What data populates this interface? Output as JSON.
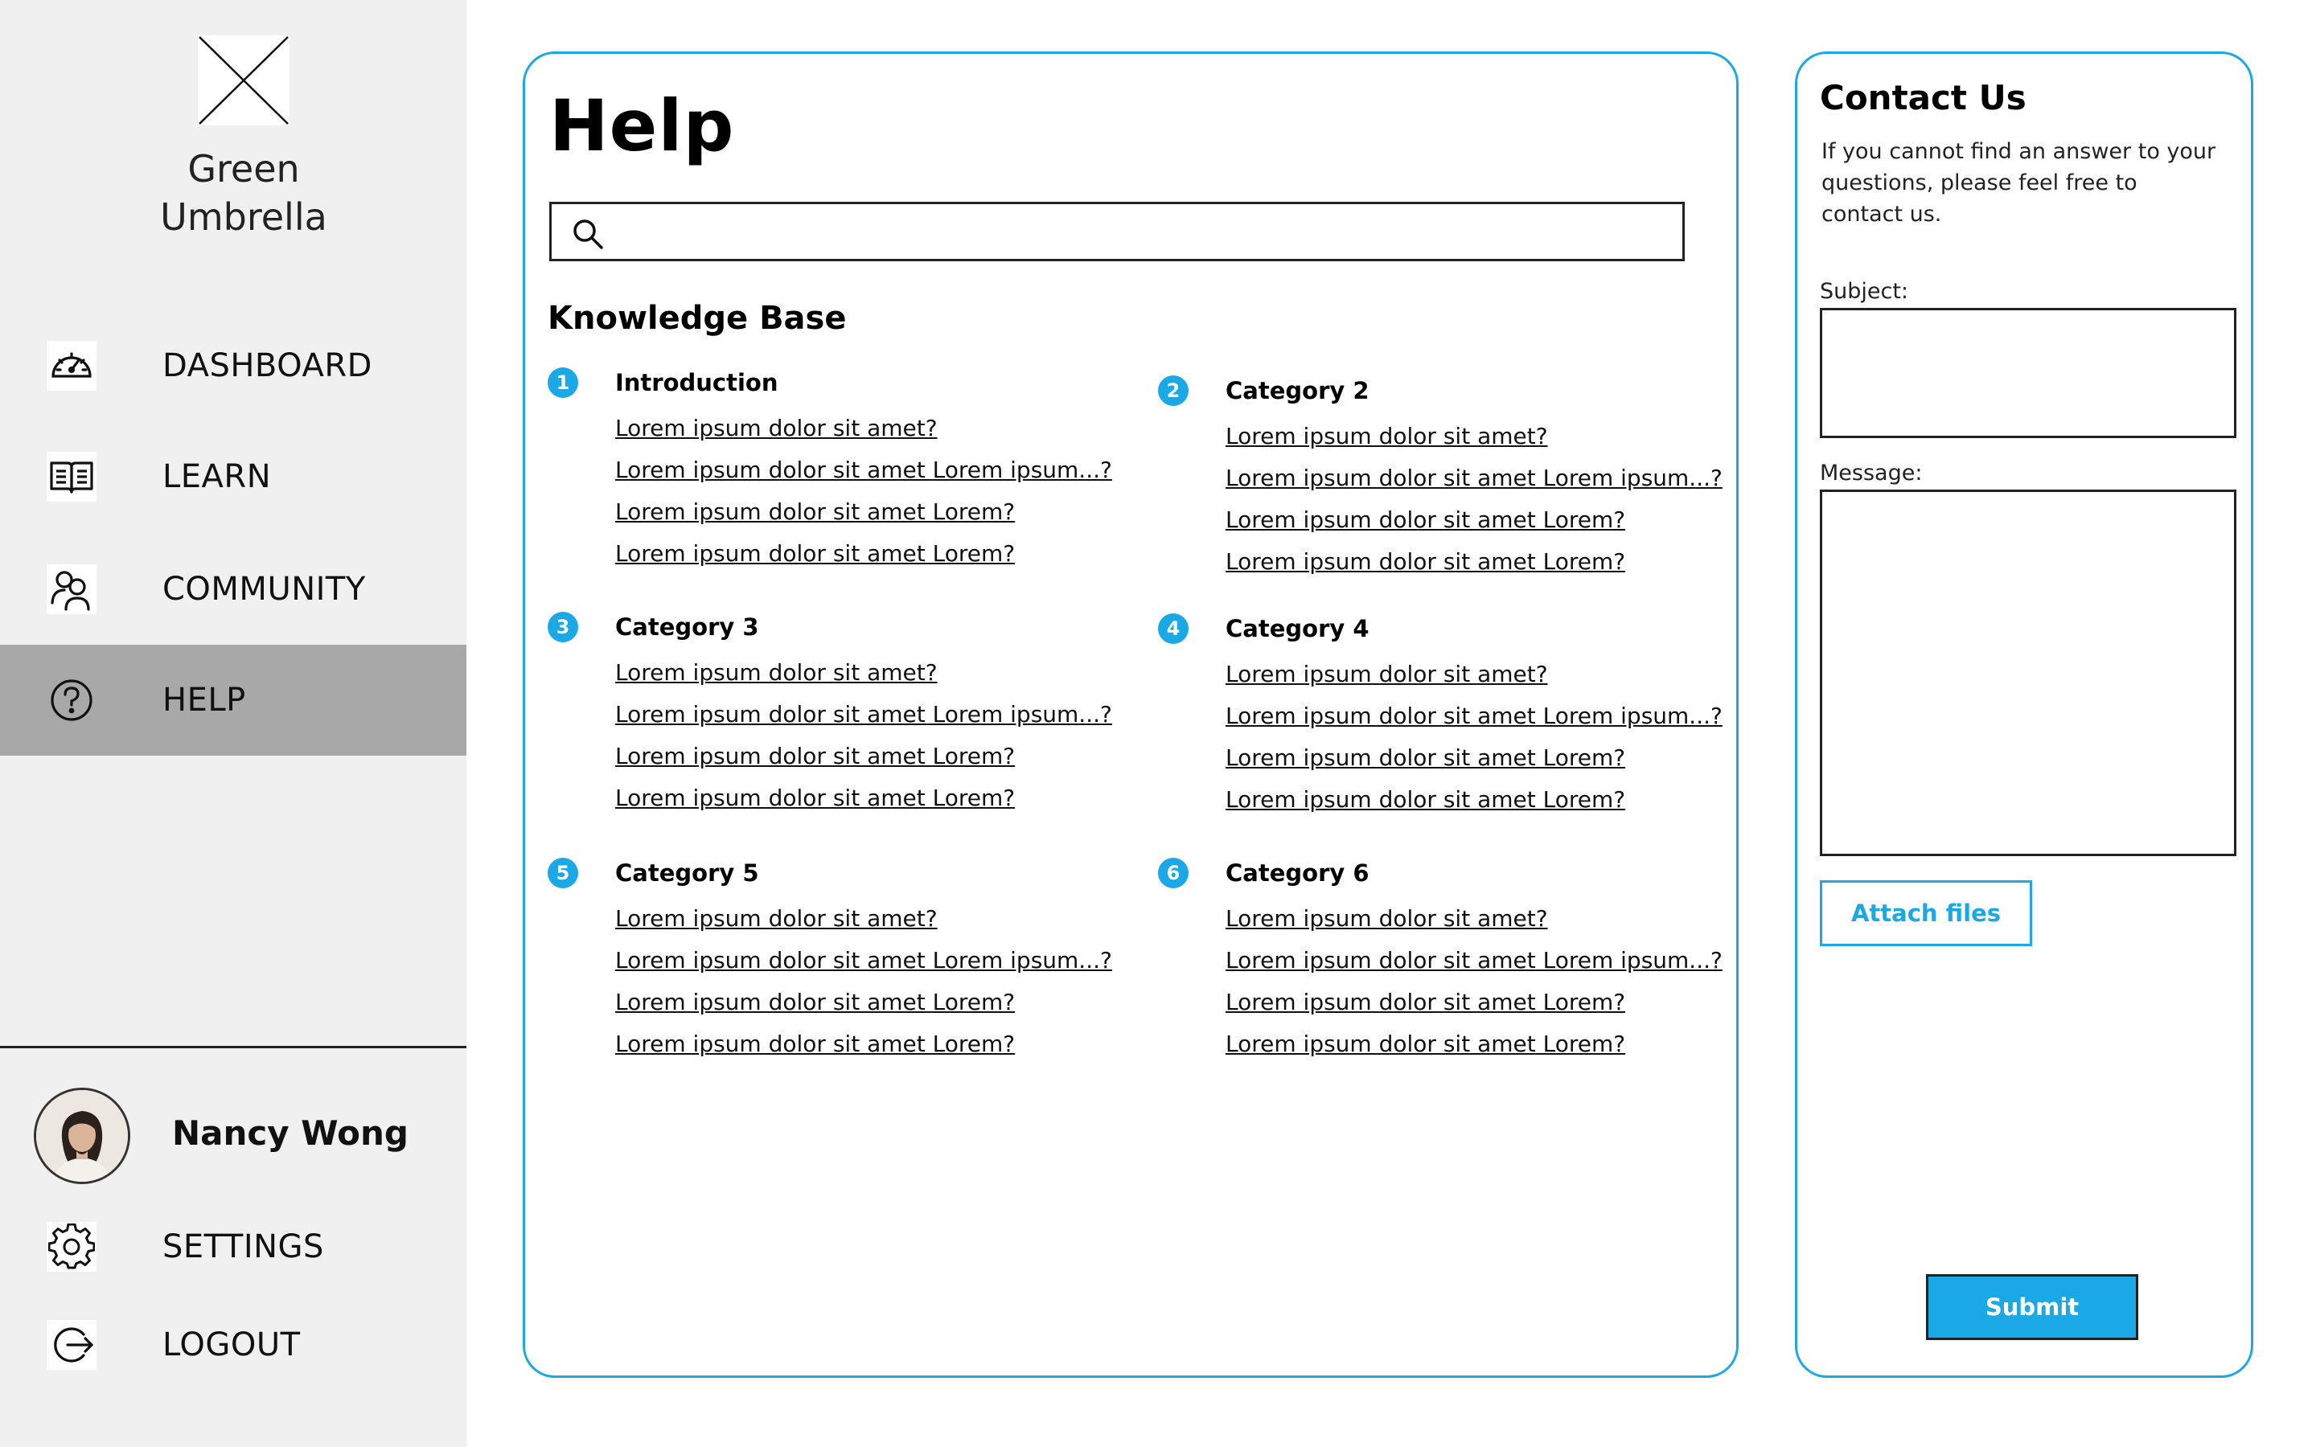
{
  "brand": {
    "line1": "Green",
    "line2": "Umbrella"
  },
  "sidebar": {
    "items": [
      {
        "label": "DASHBOARD",
        "icon": "gauge-icon"
      },
      {
        "label": "LEARN",
        "icon": "book-icon"
      },
      {
        "label": "COMMUNITY",
        "icon": "users-icon"
      },
      {
        "label": "HELP",
        "icon": "help-circle-icon",
        "active": true
      }
    ],
    "bottom_items": [
      {
        "label": "SETTINGS",
        "icon": "gear-icon"
      },
      {
        "label": "LOGOUT",
        "icon": "logout-icon"
      }
    ]
  },
  "user": {
    "name": "Nancy Wong"
  },
  "help": {
    "title": "Help",
    "search": {
      "value": "",
      "placeholder": ""
    },
    "kb_title": "Knowledge Base",
    "categories": [
      {
        "num": "1",
        "title": "Introduction",
        "links": [
          "Lorem ipsum dolor sit amet?",
          "Lorem ipsum dolor sit amet Lorem ipsum...?",
          "Lorem ipsum dolor sit amet Lorem?",
          "Lorem ipsum dolor sit amet Lorem?"
        ]
      },
      {
        "num": "2",
        "title": "Category 2",
        "links": [
          "Lorem ipsum dolor sit amet?",
          "Lorem ipsum dolor sit amet Lorem ipsum...?",
          "Lorem ipsum dolor sit amet Lorem?",
          "Lorem ipsum dolor sit amet Lorem?"
        ]
      },
      {
        "num": "3",
        "title": "Category 3",
        "links": [
          "Lorem ipsum dolor sit amet?",
          "Lorem ipsum dolor sit amet Lorem ipsum...?",
          "Lorem ipsum dolor sit amet Lorem?",
          "Lorem ipsum dolor sit amet Lorem?"
        ]
      },
      {
        "num": "4",
        "title": "Category 4",
        "links": [
          "Lorem ipsum dolor sit amet?",
          "Lorem ipsum dolor sit amet Lorem ipsum...?",
          "Lorem ipsum dolor sit amet Lorem?",
          "Lorem ipsum dolor sit amet Lorem?"
        ]
      },
      {
        "num": "5",
        "title": "Category 5",
        "links": [
          "Lorem ipsum dolor sit amet?",
          "Lorem ipsum dolor sit amet Lorem ipsum...?",
          "Lorem ipsum dolor sit amet Lorem?",
          "Lorem ipsum dolor sit amet Lorem?"
        ]
      },
      {
        "num": "6",
        "title": "Category 6",
        "links": [
          "Lorem ipsum dolor sit amet?",
          "Lorem ipsum dolor sit amet Lorem ipsum...?",
          "Lorem ipsum dolor sit amet Lorem?",
          "Lorem ipsum dolor sit amet Lorem?"
        ]
      }
    ]
  },
  "contact": {
    "title": "Contact Us",
    "description": "If you cannot find an answer to your questions, please feel free to contact us.",
    "subject_label": "Subject:",
    "subject_value": "",
    "message_label": "Message:",
    "message_value": "",
    "attach_label": "Attach files",
    "submit_label": "Submit"
  },
  "colors": {
    "accent": "#1aa9e6",
    "sidebar_bg": "#f0f0f0",
    "active_bg": "#a8a8a8"
  }
}
